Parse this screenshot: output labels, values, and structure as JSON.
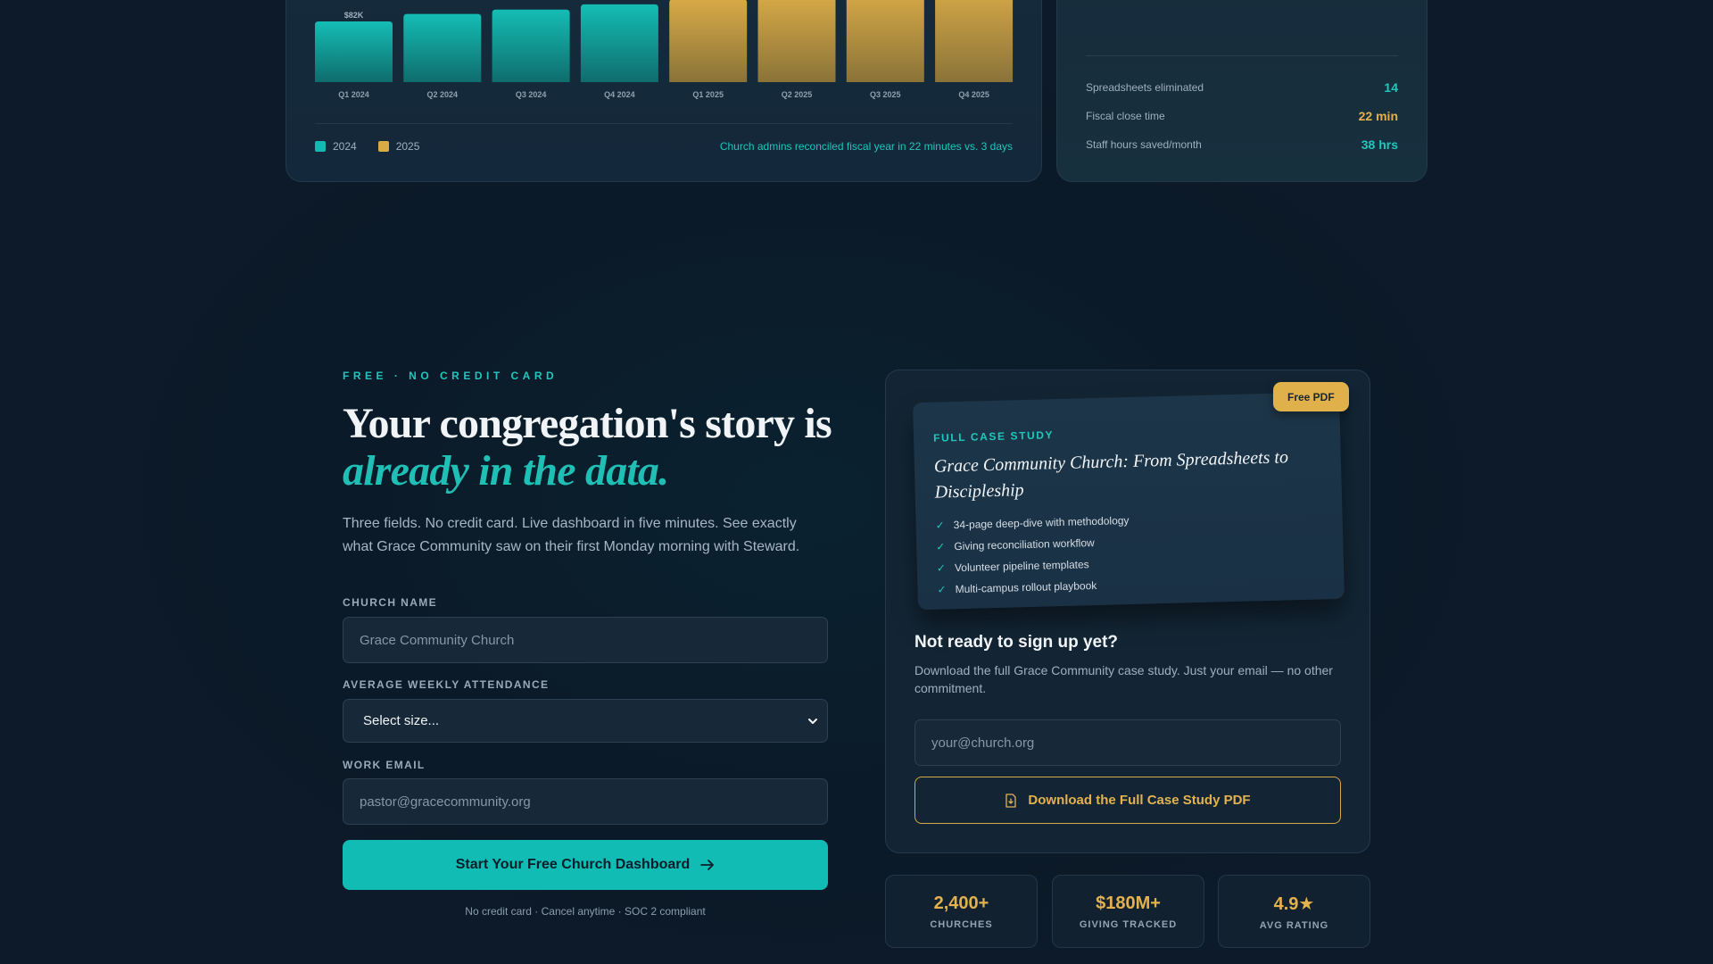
{
  "chart_data": {
    "type": "bar",
    "categories": [
      "Q1 2024",
      "Q2 2024",
      "Q3 2024",
      "Q4 2024",
      "Q1 2025",
      "Q2 2025",
      "Q3 2025",
      "Q4 2025"
    ],
    "series": [
      {
        "name": "2024",
        "values": [
          82,
          92,
          98,
          105,
          null,
          null,
          null,
          null
        ]
      },
      {
        "name": "2025",
        "values": [
          null,
          null,
          null,
          null,
          112,
          118,
          124,
          130
        ]
      }
    ],
    "ylim": [
      0,
      150
    ],
    "top_label": "$82K",
    "legend": [
      {
        "label": "2024",
        "color": "#14b8b0"
      },
      {
        "label": "2025",
        "color": "#d9aa45"
      }
    ],
    "legend_position": "bottom-left",
    "caption": "Church admins reconciled fiscal year in 22 minutes vs. 3 days"
  },
  "stats": [
    {
      "label": "Spreadsheets eliminated",
      "value": "14",
      "color": "#1fc7bd"
    },
    {
      "label": "Fiscal close time",
      "value": "22 min",
      "color": "#e3b24f"
    },
    {
      "label": "Staff hours saved/month",
      "value": "38 hrs",
      "color": "#1fc7bd"
    }
  ],
  "signup": {
    "eyebrow": "FREE · NO CREDIT CARD",
    "headline_line1": "Your congregation's story is",
    "headline_line2": "already in the data.",
    "subtext": "Three fields. No credit card. Live dashboard in five minutes. See exactly what Grace Community saw on their first Monday morning with Steward.",
    "church_label": "CHURCH NAME",
    "church_placeholder": "Grace Community Church",
    "attendance_label": "AVERAGE WEEKLY ATTENDANCE",
    "attendance_selected": "Select size...",
    "email_label": "WORK EMAIL",
    "email_placeholder": "pastor@gracecommunity.org",
    "cta_label": "Start Your Free Church Dashboard",
    "fineprint": "No credit card · Cancel anytime · SOC 2 compliant"
  },
  "case_study": {
    "badge": "Free PDF",
    "eyebrow": "FULL CASE STUDY",
    "title": "Grace Community Church: From Spreadsheets to Discipleship",
    "items": [
      "34-page deep-dive with methodology",
      "Giving reconciliation workflow",
      "Volunteer pipeline templates",
      "Multi-campus rollout playbook"
    ],
    "lead_title": "Not ready to sign up yet?",
    "lead_desc": "Download the full Grace Community case study. Just your email — no other commitment.",
    "email_placeholder": "your@church.org",
    "download_label": "Download the Full Case Study PDF"
  },
  "metrics": [
    {
      "value": "2,400+",
      "label": "CHURCHES"
    },
    {
      "value": "$180M+",
      "label": "GIVING TRACKED"
    },
    {
      "value": "4.9★",
      "label": "AVG RATING"
    }
  ]
}
